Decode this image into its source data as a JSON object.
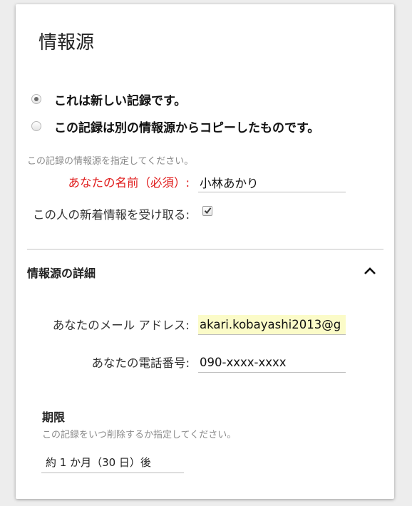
{
  "panel": {
    "title": "情報源"
  },
  "record_type": {
    "options": [
      {
        "label": "これは新しい記録です。",
        "selected": true
      },
      {
        "label": "この記録は別の情報源からコピーしたものです。",
        "selected": false
      }
    ]
  },
  "source": {
    "hint": "この記録の情報源を指定してください。",
    "name_label": "あなたの名前（必須）:",
    "name_value": "小林あかり",
    "subscribe_label": "この人の新着情報を受け取る:",
    "subscribe_checked": true
  },
  "details": {
    "section_title": "情報源の詳細",
    "email_label": "あなたのメール アドレス:",
    "email_value": "akari.kobayashi2013@g",
    "phone_label": "あなたの電話番号:",
    "phone_value": "090-xxxx-xxxx"
  },
  "deadline": {
    "title": "期限",
    "hint": "この記録をいつ削除するか指定してください。",
    "selected_option": "約 1 か月（30 日）後"
  },
  "colors": {
    "required_label": "#e01b1b",
    "autofill_background": "#fbfbc8"
  }
}
